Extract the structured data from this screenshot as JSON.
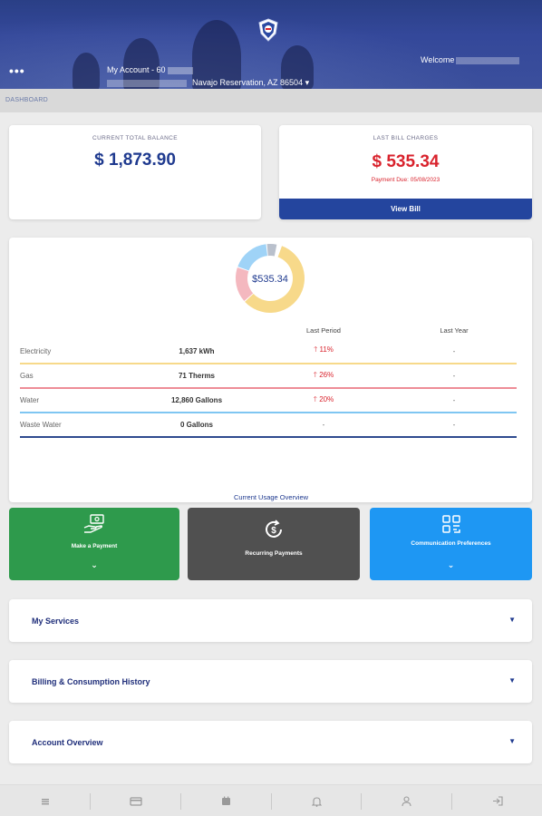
{
  "header": {
    "menu_icon": "more-dots-icon",
    "account_label": "My Account - 60",
    "address_label": "Navajo Reservation, AZ 86504 ▾",
    "welcome_label": "Welcome"
  },
  "breadcrumb": {
    "label": "DASHBOARD"
  },
  "balance": {
    "label": "CURRENT TOTAL BALANCE",
    "amount": "$ 1,873.90"
  },
  "last_bill": {
    "label": "LAST BILL CHARGES",
    "amount": "$ 535.34",
    "due": "Payment Due: 05/08/2023",
    "button": "View Bill"
  },
  "donut": {
    "center_label": "$535.34",
    "segments": [
      {
        "name": "Electricity",
        "fraction": 0.58,
        "color": "#f7d98a"
      },
      {
        "name": "Gas",
        "fraction": 0.17,
        "color": "#f4b8bf"
      },
      {
        "name": "Water",
        "fraction": 0.18,
        "color": "#9fd3f7"
      },
      {
        "name": "Waste Water",
        "fraction": 0.05,
        "color": "#b9c0cc"
      }
    ]
  },
  "usage_table": {
    "headers": [
      "",
      "",
      "Last Period",
      "Last Year"
    ],
    "rows": [
      {
        "name": "Electricity",
        "value": "1,637 kWh",
        "last_period": "11%",
        "last_year": "-",
        "color": "#f7d98a",
        "up": true
      },
      {
        "name": "Gas",
        "value": "71 Therms",
        "last_period": "26%",
        "last_year": "-",
        "color": "#ee8d97",
        "up": true
      },
      {
        "name": "Water",
        "value": "12,860 Gallons",
        "last_period": "20%",
        "last_year": "-",
        "color": "#7fc6f2",
        "up": true
      },
      {
        "name": "Waste Water",
        "value": "0 Gallons",
        "last_period": "-",
        "last_year": "-",
        "color": "#2e4a8f",
        "up": false
      }
    ],
    "caption": "Current Usage Overview"
  },
  "tiles": {
    "payment": {
      "label": "Make a Payment",
      "color": "#2e9a4c"
    },
    "recurring": {
      "label": "Recurring Payments",
      "color": "#505050"
    },
    "comm": {
      "label": "Communication Preferences",
      "color": "#1e97f3"
    }
  },
  "accordions": {
    "services": "My Services",
    "billing": "Billing & Consumption History",
    "overview": "Account Overview"
  },
  "bottom_nav": [
    "home-icon",
    "card-icon",
    "calendar-icon",
    "bell-icon",
    "user-icon",
    "logout-icon"
  ]
}
